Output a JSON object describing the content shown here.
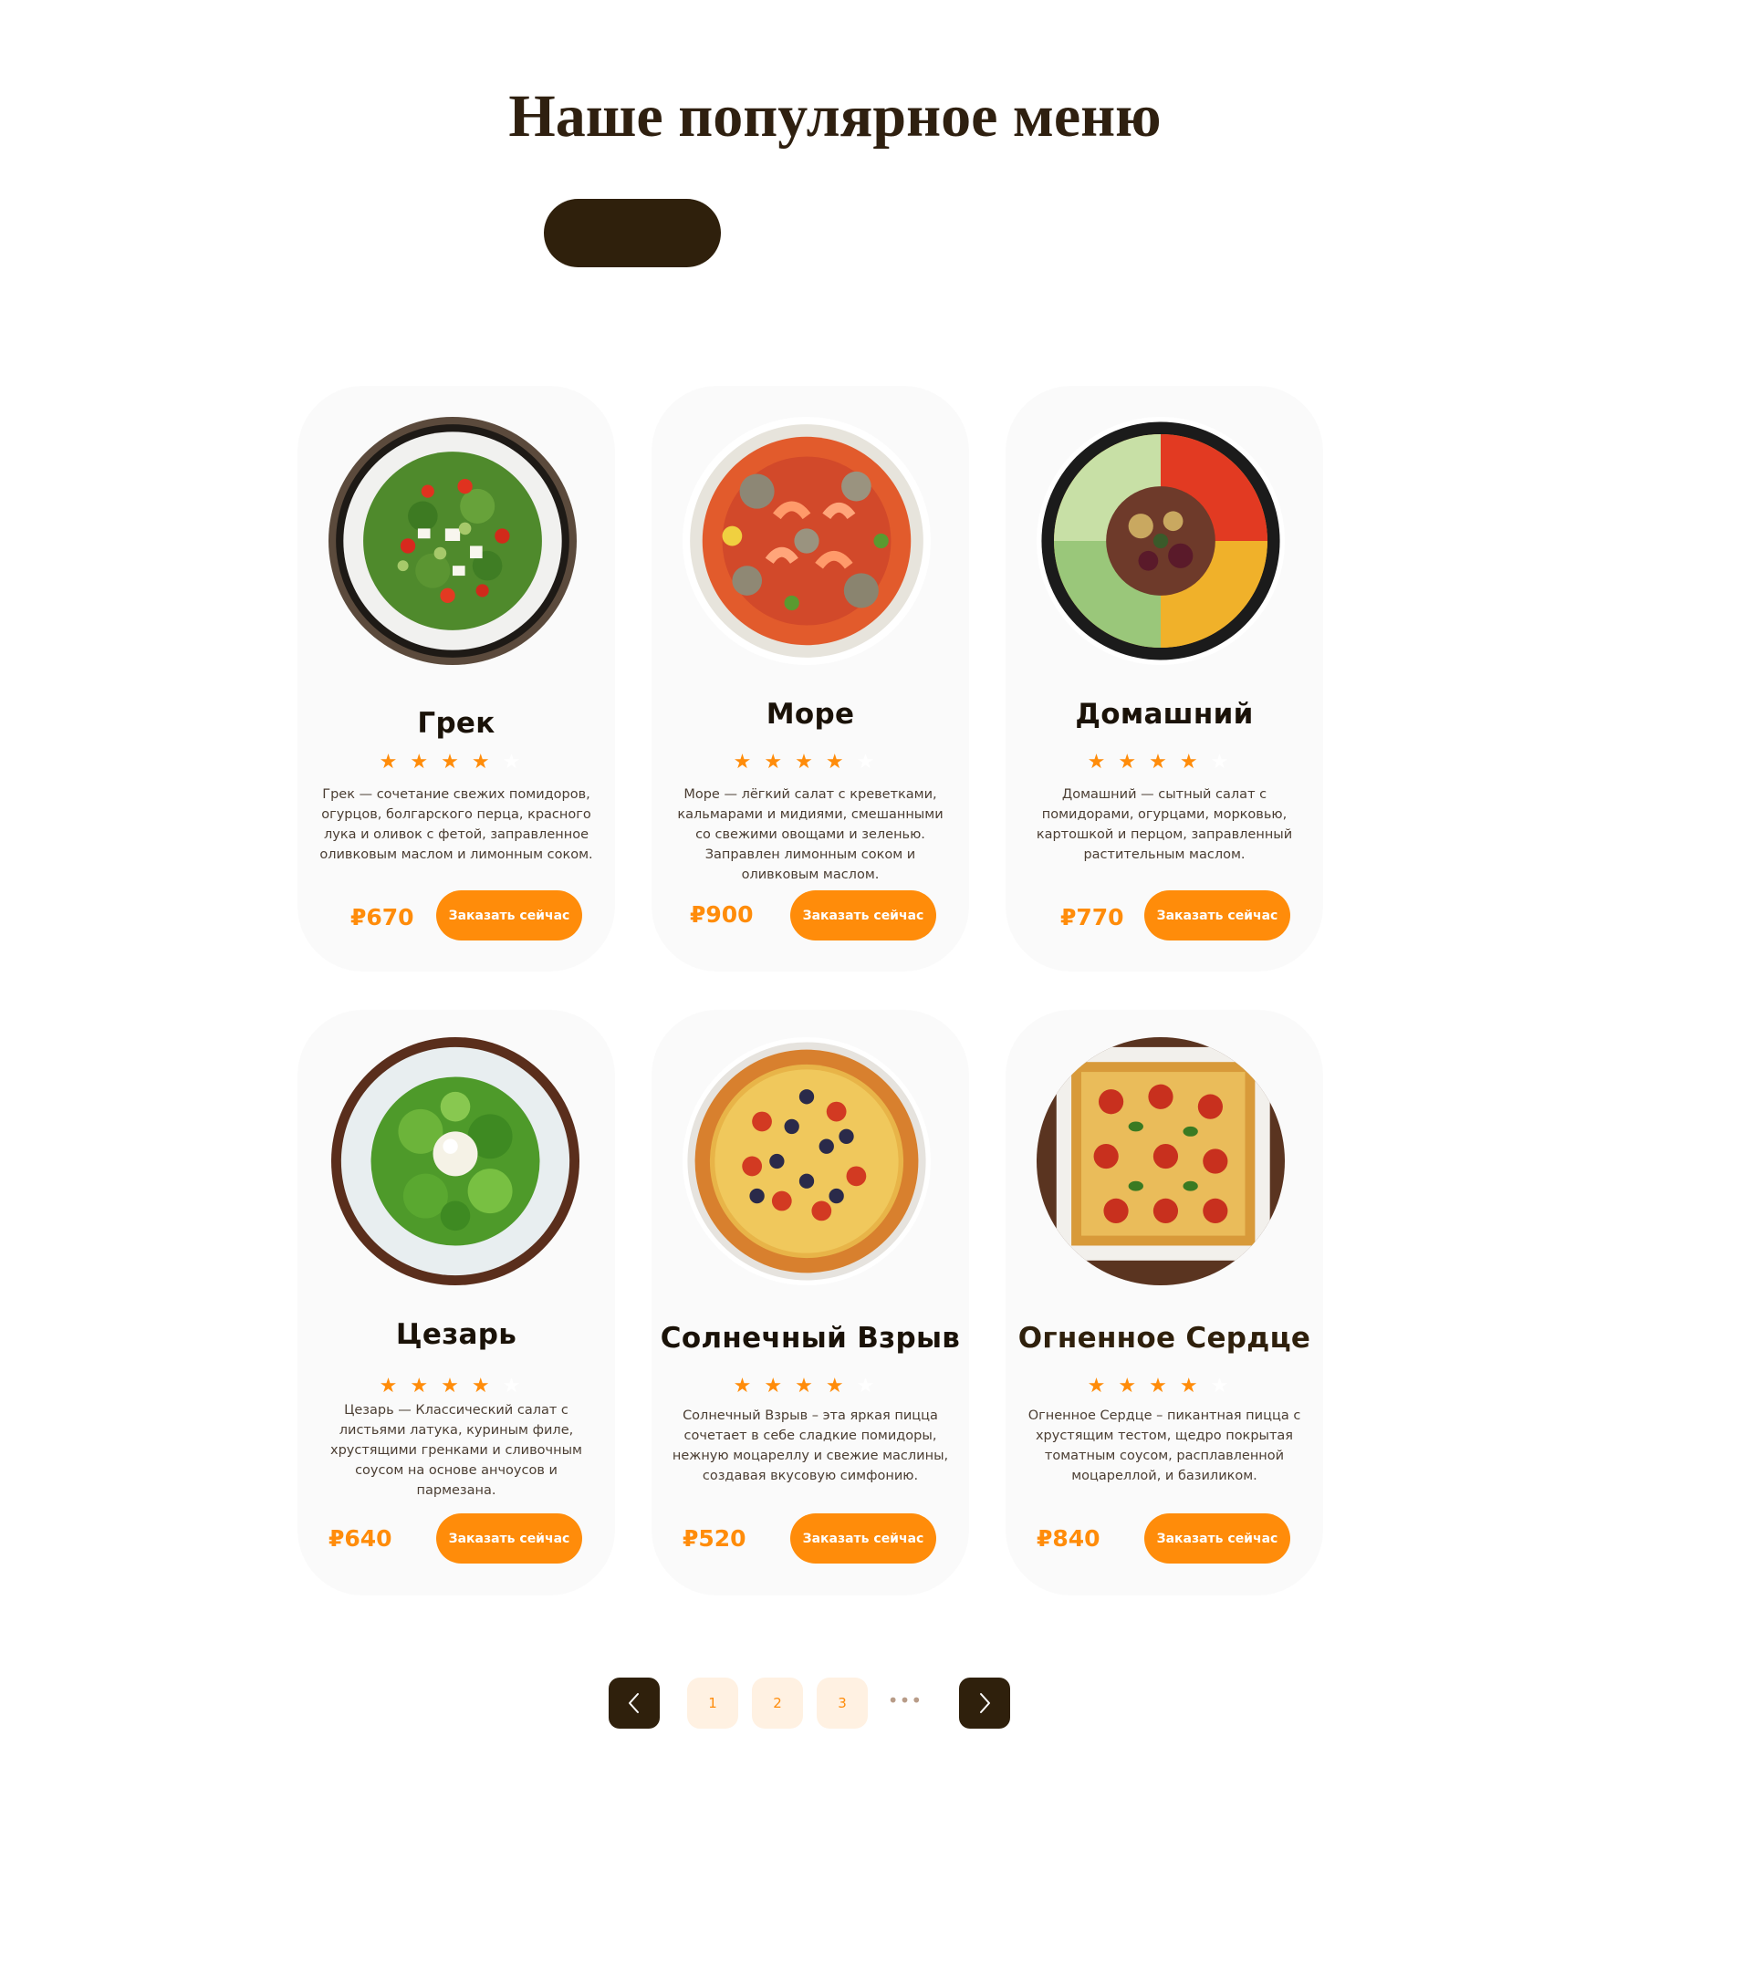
{
  "section": {
    "title": "Наше популярное меню"
  },
  "currency_symbol": "₽",
  "colors": {
    "accent": "#ff8c0a",
    "dark": "#2f200c",
    "card_bg": "#fafafa",
    "page_bg": "#ffffff"
  },
  "cards": [
    {
      "name": "Грек",
      "rating": 4,
      "description": "Грек — сочетание свежих помидоров, огурцов, болгарского перца, красного лука и оливок с фетой, заправленное оливковым маслом и лимонным соком.",
      "price": "₽670",
      "button": "Заказать сейчас"
    },
    {
      "name": "Море",
      "rating": 4,
      "description": "Море — лёгкий салат с креветками, кальмарами и мидиями, смешанными со свежими овощами и зеленью. Заправлен лимонным соком и оливковым маслом.",
      "price": "₽900",
      "button": "Заказать сейчас"
    },
    {
      "name": "Домашний",
      "rating": 4,
      "description": "Домашний — сытный салат с помидорами, огурцами, морковью, картошкой и перцом, заправленный растительным маслом.",
      "price": "₽770",
      "button": "Заказать сейчас"
    },
    {
      "name": "Цезарь",
      "rating": 4,
      "description": "Цезарь — Классический салат с листьями латука, куриным филе, хрустящими гренками и сливочным соусом на основе анчоусов и пармезана.",
      "price": "₽640",
      "button": "Заказать сейчас"
    },
    {
      "name": "Солнечный Взрыв",
      "rating": 4,
      "description": "Солнечный Взрыв – эта яркая пицца сочетает в себе сладкие помидоры, нежную моцареллу и свежие маслины, создавая вкусовую симфонию.",
      "price": "₽520",
      "button": "Заказать сейчас"
    },
    {
      "name": "Огненное Сердце",
      "rating": 4,
      "description": "Огненное Сердце – пикантная пицца с хрустящим тестом, щедро покрытая томатным соусом, расплавленной моцареллой, и базиликом.",
      "price": "₽840",
      "button": "Заказать сейчас"
    }
  ],
  "pagination": {
    "pages": [
      "1",
      "2",
      "3"
    ],
    "ellipsis": "•••"
  }
}
